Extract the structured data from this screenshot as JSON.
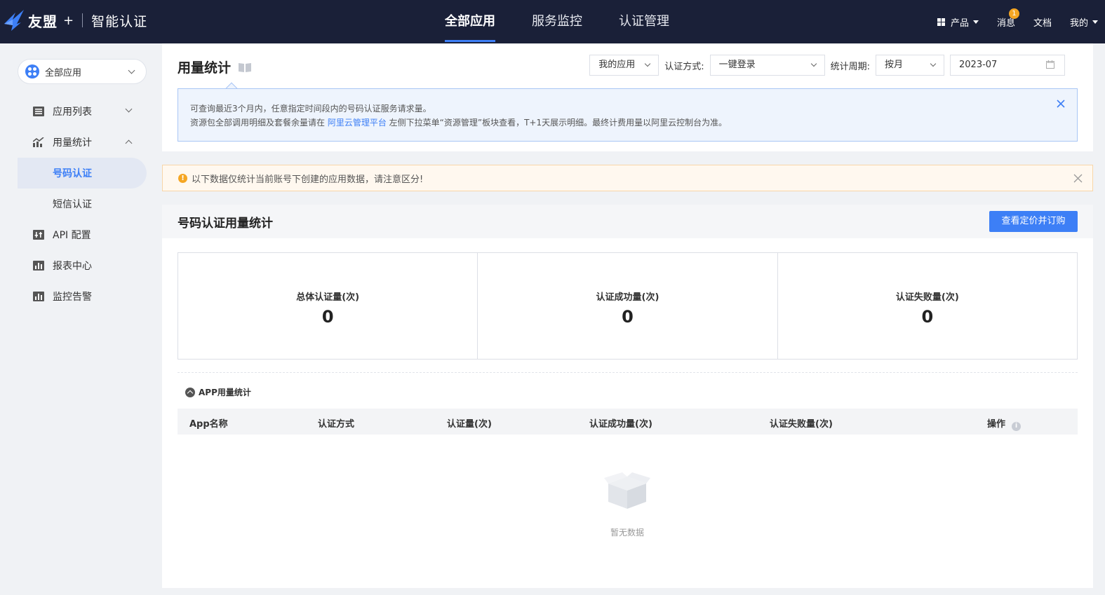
{
  "header": {
    "brand": "友盟",
    "plus": "+",
    "product": "智能认证",
    "nav": [
      {
        "label": "全部应用",
        "active": true
      },
      {
        "label": "服务监控",
        "active": false
      },
      {
        "label": "认证管理",
        "active": false
      }
    ],
    "right": {
      "products": "产品",
      "messages": "消息",
      "messages_badge": "1",
      "docs": "文档",
      "mine": "我的"
    },
    "icons": {
      "logo": "youmeng-bird-logo",
      "products": "grid-icon"
    }
  },
  "sidebar": {
    "app_select": "全部应用",
    "menu": [
      {
        "label": "应用列表",
        "icon": "list-icon",
        "expanded": false
      },
      {
        "label": "用量统计",
        "icon": "chart-icon",
        "expanded": true
      },
      {
        "label": "号码认证",
        "sub": true,
        "active": true
      },
      {
        "label": "短信认证",
        "sub": true,
        "active": false
      },
      {
        "label": "API 配置",
        "icon": "api-icon"
      },
      {
        "label": "报表中心",
        "icon": "report-icon"
      },
      {
        "label": "监控告警",
        "icon": "monitor-icon"
      }
    ]
  },
  "page": {
    "title": "用量统计",
    "filters": {
      "my_app": "我的应用",
      "auth_label": "认证方式:",
      "auth_value": "一键登录",
      "period_label": "统计周期:",
      "period_value": "按月",
      "date_value": "2023-07"
    },
    "tip": {
      "line1": "可查询最近3个月内，任意指定时间段内的号码认证服务请求量。",
      "line2_pre": "资源包全部调用明细及套餐余量请在 ",
      "line2_link": "阿里云管理平台",
      "line2_post": " 左侧下拉菜单“资源管理”板块查看，T+1天展示明细。最终计费用量以阿里云控制台为准。"
    },
    "warning": "以下数据仅统计当前账号下创建的应用数据，请注意区分!",
    "section": {
      "title": "号码认证用量统计",
      "button": "查看定价并订购",
      "stats": [
        {
          "label": "总体认证量(次)",
          "value": "0"
        },
        {
          "label": "认证成功量(次)",
          "value": "0"
        },
        {
          "label": "认证失败量(次)",
          "value": "0"
        }
      ],
      "app_stat_title": "APP用量统计",
      "columns": [
        "App名称",
        "认证方式",
        "认证量(次)",
        "认证成功量(次)",
        "认证失败量(次)",
        "操作"
      ],
      "empty": "暂无数据"
    }
  },
  "colors": {
    "accent": "#3d7ff6",
    "topbar": "#1a2038",
    "warning": "#f5a623"
  }
}
